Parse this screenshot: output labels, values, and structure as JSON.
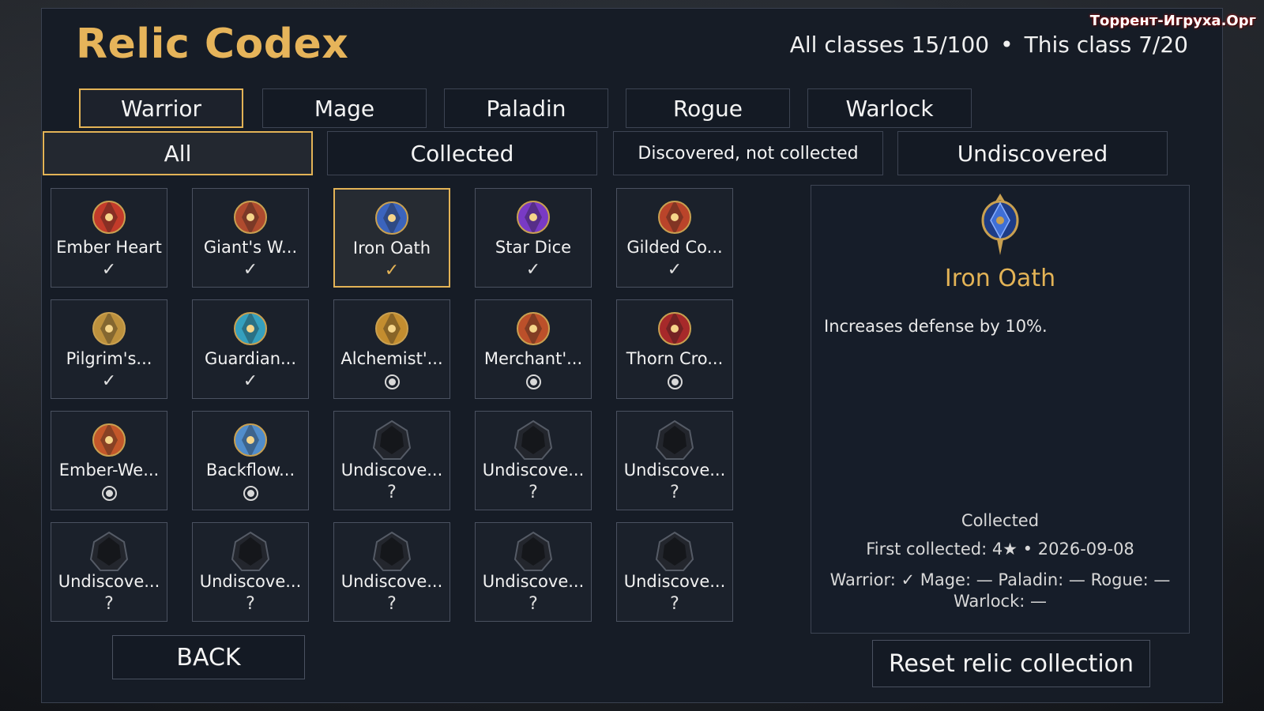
{
  "watermark": "Торрент-Игруха.Орг",
  "header": {
    "title": "Relic Codex",
    "all_classes": "All classes 15/100",
    "separator": "•",
    "this_class": "This class 7/20"
  },
  "class_tabs": [
    {
      "label": "Warrior",
      "active": true
    },
    {
      "label": "Mage",
      "active": false
    },
    {
      "label": "Paladin",
      "active": false
    },
    {
      "label": "Rogue",
      "active": false
    },
    {
      "label": "Warlock",
      "active": false
    }
  ],
  "filters": [
    {
      "label": "All",
      "active": true
    },
    {
      "label": "Collected",
      "active": false
    },
    {
      "label": "Discovered, not collected",
      "active": false
    },
    {
      "label": "Undiscovered",
      "active": false
    }
  ],
  "relics": [
    {
      "name": "Ember Heart",
      "status": "✓",
      "icon": "ember-heart-icon",
      "color": "#e0402a"
    },
    {
      "name": "Giant's W...",
      "status": "✓",
      "icon": "giants-wrist-icon",
      "color": "#c9522f"
    },
    {
      "name": "Iron Oath",
      "status": "✓",
      "icon": "iron-oath-icon",
      "color": "#3f6fd6",
      "selected": true
    },
    {
      "name": "Star Dice",
      "status": "✓",
      "icon": "star-dice-icon",
      "color": "#8a3ee0"
    },
    {
      "name": "Gilded Co...",
      "status": "✓",
      "icon": "gilded-compass-icon",
      "color": "#d64a2a"
    },
    {
      "name": "Pilgrim's...",
      "status": "✓",
      "icon": "pilgrims-chalice-icon",
      "color": "#d9a441"
    },
    {
      "name": "Guardian...",
      "status": "✓",
      "icon": "guardian-orb-icon",
      "color": "#3ab6d8"
    },
    {
      "name": "Alchemist'...",
      "status": "radio",
      "icon": "alchemist-quill-icon",
      "color": "#e0a030"
    },
    {
      "name": "Merchant'...",
      "status": "radio",
      "icon": "merchant-scale-icon",
      "color": "#d8582a"
    },
    {
      "name": "Thorn Cro...",
      "status": "radio",
      "icon": "thorn-crown-icon",
      "color": "#c02a2a"
    },
    {
      "name": "Ember-We...",
      "status": "radio",
      "icon": "ember-weave-icon",
      "color": "#e0602a"
    },
    {
      "name": "Backflow...",
      "status": "radio",
      "icon": "backflow-icon",
      "color": "#5aa0e8"
    },
    {
      "name": "Undiscove...",
      "status": "?",
      "icon": "undiscovered-icon",
      "color": "#2a2e36"
    },
    {
      "name": "Undiscove...",
      "status": "?",
      "icon": "undiscovered-icon",
      "color": "#2a2e36"
    },
    {
      "name": "Undiscove...",
      "status": "?",
      "icon": "undiscovered-icon",
      "color": "#2a2e36"
    },
    {
      "name": "Undiscove...",
      "status": "?",
      "icon": "undiscovered-icon",
      "color": "#2a2e36"
    },
    {
      "name": "Undiscove...",
      "status": "?",
      "icon": "undiscovered-icon",
      "color": "#2a2e36"
    },
    {
      "name": "Undiscove...",
      "status": "?",
      "icon": "undiscovered-icon",
      "color": "#2a2e36"
    },
    {
      "name": "Undiscove...",
      "status": "?",
      "icon": "undiscovered-icon",
      "color": "#2a2e36"
    },
    {
      "name": "Undiscove...",
      "status": "?",
      "icon": "undiscovered-icon",
      "color": "#2a2e36"
    }
  ],
  "detail": {
    "name": "Iron Oath",
    "description": "Increases defense by 10%.",
    "state": "Collected",
    "first_collected": "First collected: 4★ • 2026-09-08",
    "classes": "Warrior: ✓ Mage: — Paladin: — Rogue: — Warlock: —",
    "icon": "iron-oath-icon"
  },
  "buttons": {
    "back": "BACK",
    "reset": "Reset relic collection"
  },
  "colors": {
    "accent": "#e3b356",
    "panel": "#161c26",
    "border": "#3d4453"
  }
}
